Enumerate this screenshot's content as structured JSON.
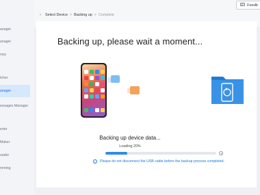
{
  "sidebar": {
    "items": [
      {
        "label": "anager",
        "active": false
      },
      {
        "label": "anager",
        "active": false
      },
      {
        "label": "rary",
        "active": false
      },
      {
        "label": "tcher",
        "active": false
      },
      {
        "label": "anager",
        "active": true
      },
      {
        "label": "essages Manager",
        "active": false
      },
      {
        "label": "erter",
        "active": false
      },
      {
        "label": "Maker",
        "active": false
      },
      {
        "label": "oader",
        "active": false
      },
      {
        "label": "mming",
        "active": false
      }
    ]
  },
  "header": {
    "back_icon": "chevron-left-icon",
    "breadcrumbs": [
      "Select Device",
      "Backing up",
      "Complete"
    ],
    "separator": ">",
    "feedback_label": "Feedb",
    "feedback_icon": "message-icon"
  },
  "main": {
    "title": "Backing up, please wait a moment...",
    "status_text": "Backing up device data...",
    "loading_text": "Loading 20%",
    "progress": 0.2,
    "notice_text": "Please do not disconnect the USB cable before the backup process completed.",
    "notice_icon": "info-icon"
  },
  "colors": {
    "accent": "#2f8be6",
    "active_bg": "#d6e8fb",
    "folder": "#3a92e6"
  }
}
